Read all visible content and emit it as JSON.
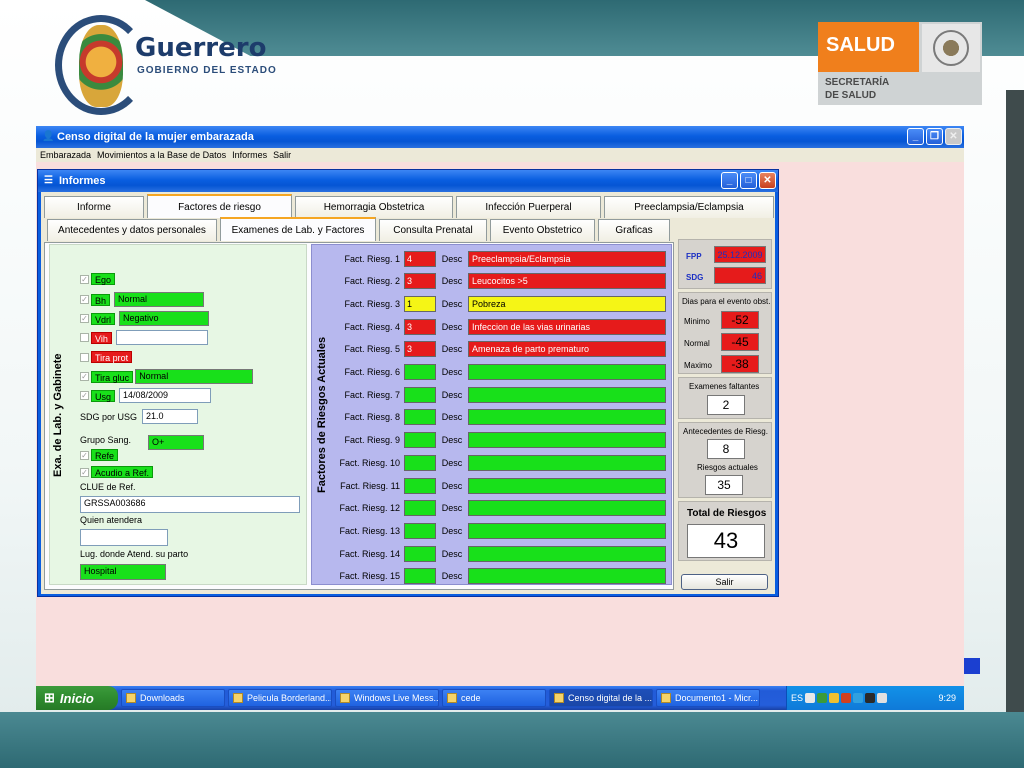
{
  "slide": {
    "guerrero_title": "Guerrero",
    "guerrero_subtitle": "GOBIERNO DEL ESTADO",
    "salud_title": "SALUD",
    "salud_secretaria_1": "SECRETARÍA",
    "salud_secretaria_2": "DE SALUD"
  },
  "app": {
    "title": "Censo digital de la mujer embarazada",
    "menu": [
      "Embarazada",
      "Movimientos a la Base de Datos",
      "Informes",
      "Salir"
    ]
  },
  "informes": {
    "title": "Informes",
    "tabs_top": [
      "Informe",
      "Factores de riesgo",
      "Hemorragia Obstetrica",
      "Infección Puerperal",
      "Preeclampsia/Eclampsia"
    ],
    "tabs_bottom": [
      "Antecedentes y datos personales",
      "Examenes de Lab. y Factores",
      "Consulta Prenatal",
      "Evento Obstetrico",
      "Graficas"
    ],
    "lab_title": "Exa. de Lab. y Gabinete",
    "lab": {
      "ego": "Ego",
      "bh": "Bh",
      "bh_value": "Normal",
      "vdrl": "Vdrl",
      "vdrl_value": "Negativo",
      "vih": "Vih",
      "vih_value": "",
      "tira_prot": "Tira prot",
      "tira_gluc": "Tira gluc",
      "tira_gluc_value": "Normal",
      "usg": "Usg",
      "usg_value": "14/08/2009",
      "sdg_usg_label": "SDG por USG",
      "sdg_usg_value": "21.0",
      "grupo_label": "Grupo Sang.",
      "grupo_value": "O+",
      "refe": "Refe",
      "acudio": "Acudio a Ref.",
      "clue_label": "CLUE de Ref.",
      "clue_value": "GRSSA003686",
      "quien_label": "Quien atendera",
      "quien_value": "",
      "lug_label": "Lug. donde Atend. su parto",
      "lug_value": "Hospital"
    },
    "risk_title": "Factores de Riesgos Actuales",
    "desc_label": "Desc",
    "risks": [
      {
        "label": "Fact. Riesg. 1",
        "code": "4",
        "desc": "Preeclampsia/Eclampsia",
        "color": "#e61b1b"
      },
      {
        "label": "Fact. Riesg. 2",
        "code": "3",
        "desc": "Leucocitos >5",
        "color": "#e61b1b"
      },
      {
        "label": "Fact. Riesg. 3",
        "code": "1",
        "desc": "Pobreza",
        "color": "#f5f516"
      },
      {
        "label": "Fact. Riesg. 4",
        "code": "3",
        "desc": "Infeccion de las vias urinarias",
        "color": "#e61b1b"
      },
      {
        "label": "Fact. Riesg. 5",
        "code": "3",
        "desc": "Amenaza de parto prematuro",
        "color": "#e61b1b"
      },
      {
        "label": "Fact. Riesg. 6",
        "code": "",
        "desc": "",
        "color": "#18e01a"
      },
      {
        "label": "Fact. Riesg. 7",
        "code": "",
        "desc": "",
        "color": "#18e01a"
      },
      {
        "label": "Fact. Riesg. 8",
        "code": "",
        "desc": "",
        "color": "#18e01a"
      },
      {
        "label": "Fact. Riesg. 9",
        "code": "",
        "desc": "",
        "color": "#18e01a"
      },
      {
        "label": "Fact. Riesg. 10",
        "code": "",
        "desc": "",
        "color": "#18e01a"
      },
      {
        "label": "Fact. Riesg. 11",
        "code": "",
        "desc": "",
        "color": "#18e01a"
      },
      {
        "label": "Fact. Riesg. 12",
        "code": "",
        "desc": "",
        "color": "#18e01a"
      },
      {
        "label": "Fact. Riesg. 13",
        "code": "",
        "desc": "",
        "color": "#18e01a"
      },
      {
        "label": "Fact. Riesg. 14",
        "code": "",
        "desc": "",
        "color": "#18e01a"
      },
      {
        "label": "Fact. Riesg. 15",
        "code": "",
        "desc": "",
        "color": "#18e01a"
      }
    ],
    "summary": {
      "fpp_label": "FPP",
      "fpp_value": "25.12.2009",
      "sdg_label": "SDG",
      "sdg_value": "46",
      "dias_title": "Dias para el evento obst.",
      "minimo_label": "Minimo",
      "minimo_value": "-52",
      "normal_label": "Normal",
      "normal_value": "-45",
      "maximo_label": "Maximo",
      "maximo_value": "-38",
      "examenes_label": "Examenes faltantes",
      "examenes_value": "2",
      "antecedentes_label": "Antecedentes de Riesg.",
      "antecedentes_value": "8",
      "riesgos_label": "Riesgos actuales",
      "riesgos_value": "35",
      "total_label": "Total de Riesgos",
      "total_value": "43"
    },
    "salir": "Salir"
  },
  "taskbar": {
    "start": "Inicio",
    "items": [
      "Downloads",
      "Pelicula Borderland...",
      "Windows Live Mess...",
      "cede",
      "Censo digital de la ...",
      "Documento1 - Micr..."
    ],
    "lang": "ES",
    "time": "9:29"
  }
}
